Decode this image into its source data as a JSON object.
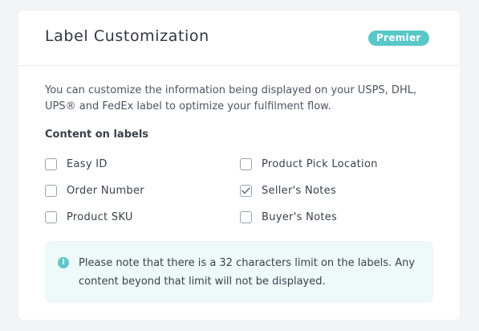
{
  "card": {
    "title": "Label Customization",
    "badge": "Premier",
    "description": "You can customize the information being displayed on your USPS, DHL, UPS® and FedEx label to optimize your fulfilment flow.",
    "section_title": "Content on labels"
  },
  "options": {
    "left": [
      {
        "label": "Easy ID",
        "checked": false
      },
      {
        "label": "Order Number",
        "checked": false
      },
      {
        "label": "Product SKU",
        "checked": false
      }
    ],
    "right": [
      {
        "label": "Product Pick Location",
        "checked": false
      },
      {
        "label": "Seller's Notes",
        "checked": true
      },
      {
        "label": "Buyer's Notes",
        "checked": false
      }
    ]
  },
  "note": {
    "icon": "info-icon",
    "icon_glyph": "!",
    "text": "Please note that there is a 32 characters limit on the labels. Any content beyond that limit will not be displayed."
  },
  "colors": {
    "accent": "#59c7c8",
    "note_bg": "#eef9f9"
  }
}
